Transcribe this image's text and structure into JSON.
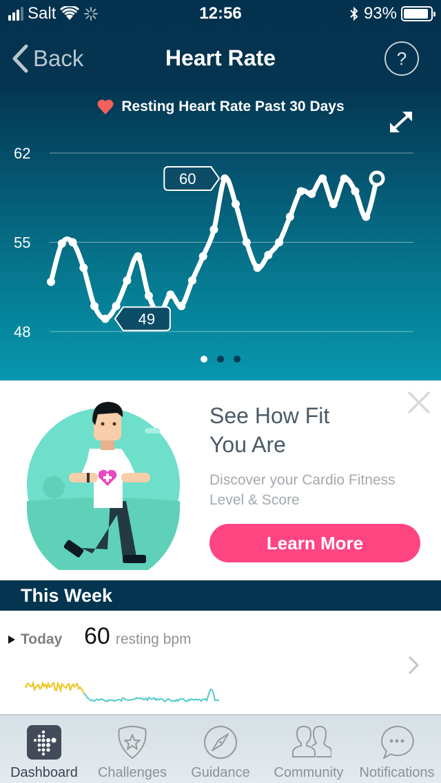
{
  "status_bar": {
    "carrier": "Salt",
    "time": "12:56",
    "battery_percent": "93%",
    "battery_level": 0.93,
    "signal_bars": 3,
    "icons": [
      "signal-icon",
      "wifi-icon",
      "activity-spinner-icon",
      "bluetooth-icon",
      "battery-icon"
    ]
  },
  "nav": {
    "back_label": "Back",
    "title": "Heart Rate",
    "help_label": "?"
  },
  "hero": {
    "chart_title": "Resting Heart Rate Past 30 Days",
    "pager": {
      "count": 3,
      "active_index": 0
    },
    "colors": {
      "heart": "#f4615c",
      "line": "#ffffff",
      "callout_bg": "#0d4c66"
    }
  },
  "chart_data": {
    "type": "line",
    "title": "Resting Heart Rate Past 30 Days",
    "xlabel": "",
    "ylabel": "",
    "ylim": [
      48,
      62
    ],
    "yticks": [
      62,
      55,
      48
    ],
    "grid": true,
    "series": [
      {
        "name": "Resting heart rate (bpm)",
        "values": [
          51.9,
          54.9,
          55,
          53,
          50,
          49,
          50,
          52,
          53.9,
          50.8,
          49.4,
          50.9,
          50,
          52,
          53.9,
          56,
          60,
          58,
          55,
          53,
          54,
          55,
          57,
          59,
          58.8,
          60,
          58,
          60,
          59,
          57,
          60
        ]
      }
    ],
    "annotations": [
      {
        "label": "60",
        "type": "max",
        "index": 16
      },
      {
        "label": "49",
        "type": "min",
        "index": 5
      }
    ],
    "last_point_marker": "hollow-circle"
  },
  "promo": {
    "title_line1": "See How Fit",
    "title_line2": "You Are",
    "desc_line1": "Discover your Cardio Fitness",
    "desc_line2": "Level & Score",
    "button_label": "Learn More",
    "button_color": "#fe4581"
  },
  "this_week": {
    "header": "This Week",
    "today": {
      "label": "Today",
      "value": "60",
      "unit": "resting bpm"
    },
    "sparkline": {
      "colors": {
        "elevated": "#f9c519",
        "resting": "#4ecbc8"
      }
    }
  },
  "tabbar": {
    "tabs": [
      {
        "label": "Dashboard",
        "icon": "fitbit-logo-icon",
        "active": true
      },
      {
        "label": "Challenges",
        "icon": "badge-star-icon",
        "active": false
      },
      {
        "label": "Guidance",
        "icon": "compass-icon",
        "active": false
      },
      {
        "label": "Community",
        "icon": "people-icon",
        "active": false
      },
      {
        "label": "Notifications",
        "icon": "chat-bubble-icon",
        "active": false
      }
    ]
  }
}
